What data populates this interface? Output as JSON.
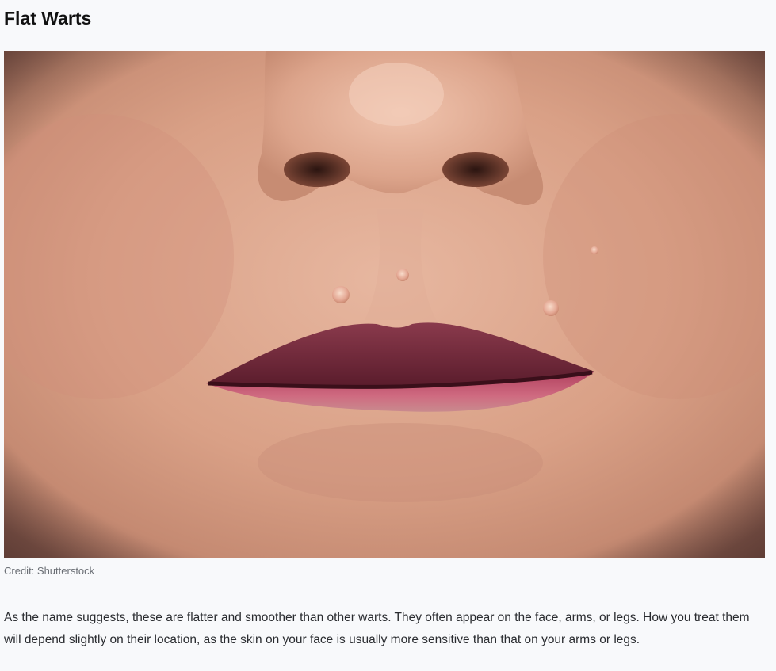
{
  "article": {
    "heading": "Flat Warts",
    "image": {
      "alt": "Close-up of flat warts around the mouth",
      "credit": "Credit: Shutterstock"
    },
    "paragraph": "As the name suggests, these are flatter and smoother than other warts. They often appear on the face, arms, or legs. How you treat them will depend slightly on their location, as the skin on your face is usually more sensitive than that on your arms or legs."
  }
}
